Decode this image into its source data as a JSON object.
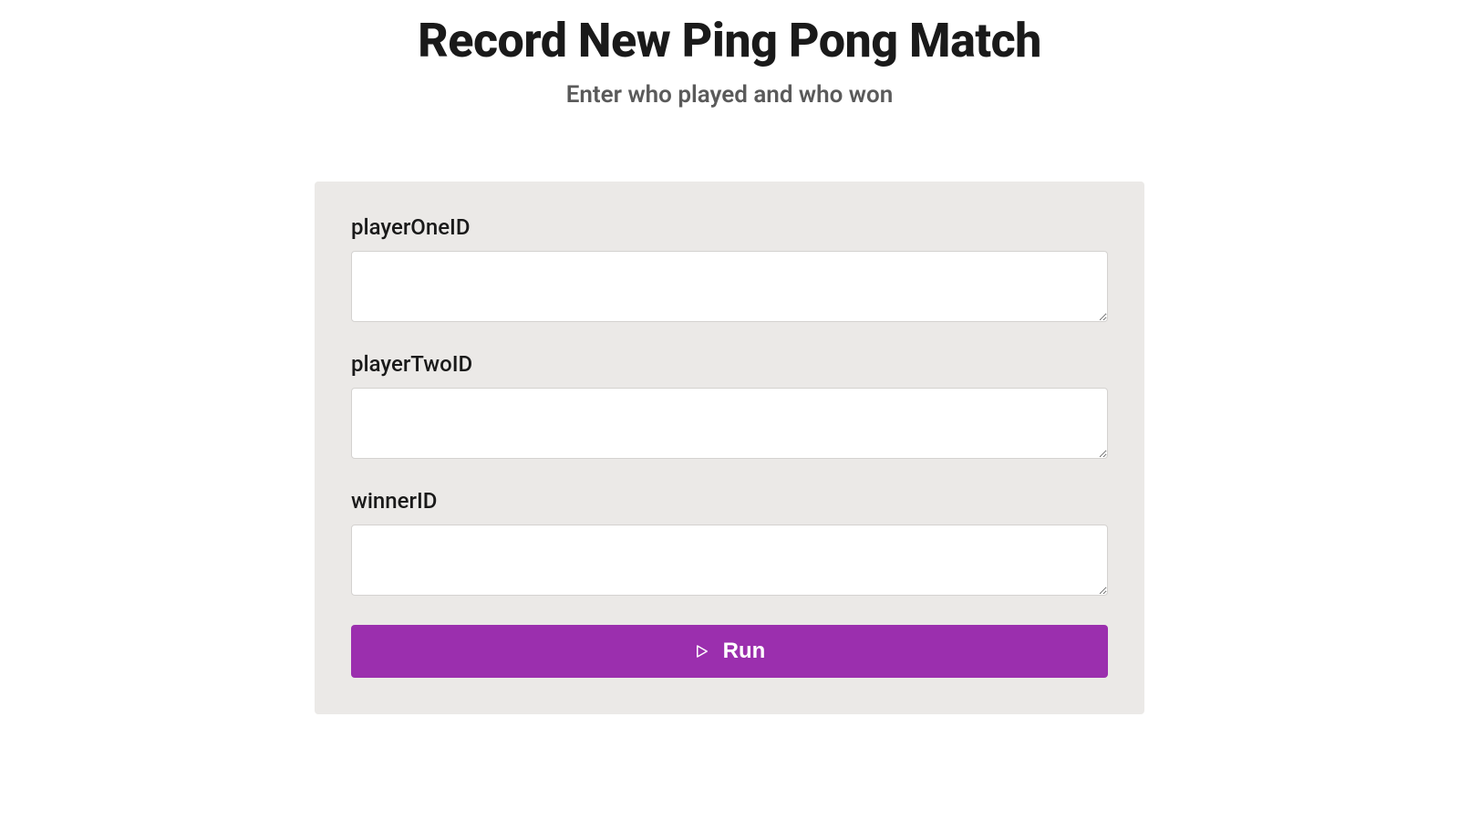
{
  "header": {
    "title": "Record New Ping Pong Match",
    "subtitle": "Enter who played and who won"
  },
  "form": {
    "fields": [
      {
        "label": "playerOneID",
        "value": ""
      },
      {
        "label": "playerTwoID",
        "value": ""
      },
      {
        "label": "winnerID",
        "value": ""
      }
    ],
    "submit_label": "Run"
  }
}
